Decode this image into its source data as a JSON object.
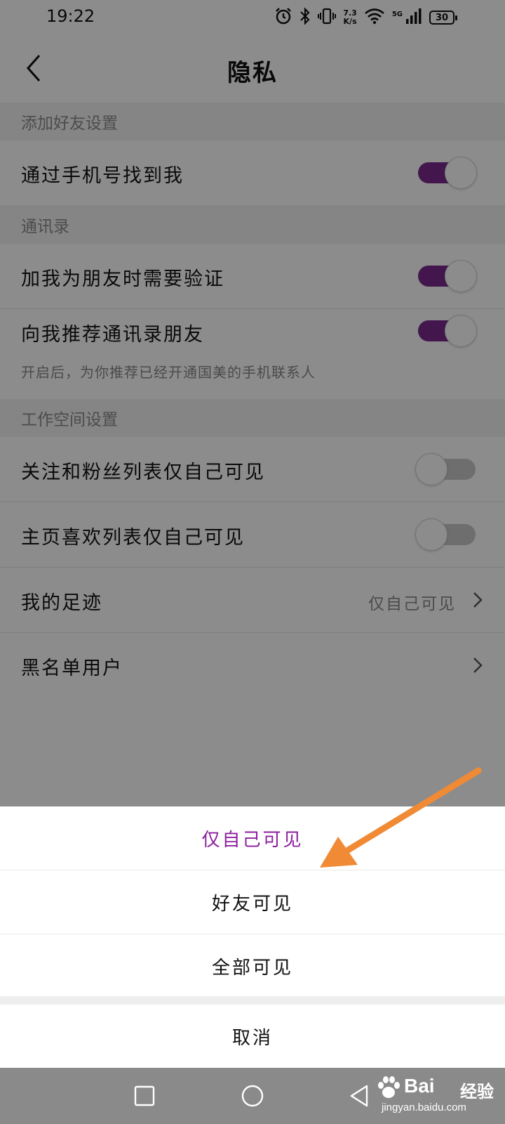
{
  "status_bar": {
    "time": "19:22",
    "net_speed_value": "7.3",
    "net_speed_unit": "K/s",
    "network_type": "5G",
    "battery": "30",
    "icons": [
      "alarm-icon",
      "bluetooth-icon",
      "vibrate-icon",
      "wifi-icon",
      "signal-icon",
      "battery-icon"
    ]
  },
  "header": {
    "title": "隐私",
    "back_icon": "chevron-left-icon"
  },
  "sections": {
    "add_friend": {
      "title": "添加好友设置",
      "rows": [
        {
          "label": "通过手机号找到我",
          "toggle_on": true
        }
      ]
    },
    "contacts": {
      "title": "通讯录",
      "rows": [
        {
          "label": "加我为朋友时需要验证",
          "toggle_on": true
        },
        {
          "label": "向我推荐通讯录朋友",
          "toggle_on": true,
          "sub": "开启后，为你推荐已经开通国美的手机联系人"
        }
      ]
    },
    "workspace": {
      "title": "工作空间设置",
      "rows": [
        {
          "label": "关注和粉丝列表仅自己可见",
          "toggle_on": false
        },
        {
          "label": "主页喜欢列表仅自己可见",
          "toggle_on": false
        },
        {
          "label": "我的足迹",
          "value": "仅自己可见"
        },
        {
          "label": "黑名单用户"
        }
      ]
    }
  },
  "sheet": {
    "options": [
      {
        "label": "仅自己可见",
        "selected": true
      },
      {
        "label": "好友可见",
        "selected": false
      },
      {
        "label": "全部可见",
        "selected": false
      }
    ],
    "cancel": "取消"
  },
  "nav_bar": {
    "icons": [
      "recent-apps-icon",
      "home-icon",
      "back-icon"
    ]
  },
  "watermark": {
    "brand": "Bai",
    "brand_suffix": "经验",
    "url": "jingyan.baidu.com"
  },
  "colors": {
    "accent": "#7a2a8f",
    "selected_option": "#8d1f9f",
    "annotation_arrow": "#f08a35"
  }
}
